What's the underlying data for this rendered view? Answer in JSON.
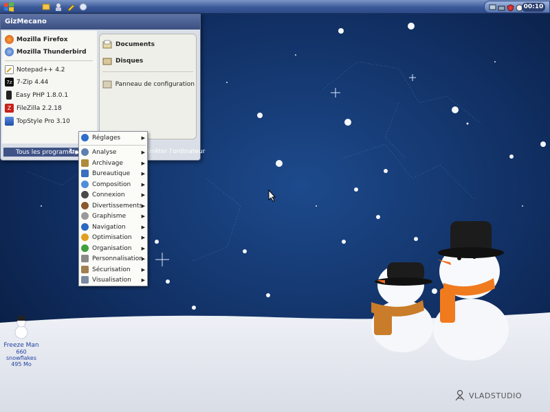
{
  "taskbar": {
    "clock": "00:10"
  },
  "start_menu": {
    "user_name": "GizMecano",
    "pinned": [
      {
        "label": "Mozilla Firefox",
        "icon": "firefox-icon"
      },
      {
        "label": "Mozilla Thunderbird",
        "icon": "thunderbird-icon"
      }
    ],
    "recent": [
      {
        "label": "Notepad++ 4.2",
        "icon": "notepad-icon"
      },
      {
        "label": "7-Zip 4.44",
        "icon": "7zip-icon"
      },
      {
        "label": "Easy PHP 1.8.0.1",
        "icon": "easyphp-icon"
      },
      {
        "label": "FileZilla 2.2.18",
        "icon": "filezilla-icon"
      },
      {
        "label": "TopStyle Pro 3.10",
        "icon": "topstyle-icon"
      }
    ],
    "all_programs": "Tous les programmes",
    "right": {
      "documents": "Documents",
      "disks": "Disques",
      "control_panel": "Panneau de configuration"
    },
    "shutdown": "Arrêter l'ordinateur"
  },
  "submenu": {
    "items": [
      {
        "label": "Réglages",
        "color": "#2d6fc9"
      },
      {
        "label": "Analyse",
        "color": "#5f7fb0"
      },
      {
        "label": "Archivage",
        "color": "#b08a3a"
      },
      {
        "label": "Bureautique",
        "color": "#3a6fc0"
      },
      {
        "label": "Composition",
        "color": "#4d8fd8"
      },
      {
        "label": "Connexion",
        "color": "#4a4a4a"
      },
      {
        "label": "Divertissements",
        "color": "#8a5a2a"
      },
      {
        "label": "Graphisme",
        "color": "#9a9a9a"
      },
      {
        "label": "Navigation",
        "color": "#2a6ac0"
      },
      {
        "label": "Optimisation",
        "color": "#e0a020"
      },
      {
        "label": "Organisation",
        "color": "#40a040"
      },
      {
        "label": "Personnalisation",
        "color": "#8a8a8a"
      },
      {
        "label": "Sécurisation",
        "color": "#a08050"
      },
      {
        "label": "Visualisation",
        "color": "#7a8aa0"
      }
    ]
  },
  "desktop": {
    "freeze_man": {
      "title": "Freeze Man",
      "line2": "660 snowflakes",
      "line3": "495 Mo"
    },
    "watermark": "VLADSTUDIO"
  }
}
